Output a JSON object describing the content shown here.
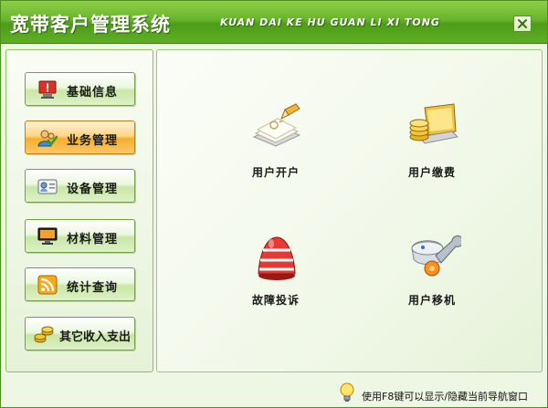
{
  "window": {
    "title": "宽带客户管理系统",
    "title_pinyin": "KUAN DAI KE HU GUAN LI XI TONG",
    "close_icon": "close-icon"
  },
  "sidebar": {
    "items": [
      {
        "label": "基础信息",
        "icon": "monitor-warning-icon",
        "active": false
      },
      {
        "label": "业务管理",
        "icon": "people-check-icon",
        "active": true
      },
      {
        "label": "设备管理",
        "icon": "contacts-card-icon",
        "active": false
      },
      {
        "label": "材料管理",
        "icon": "display-monitor-icon",
        "active": false
      },
      {
        "label": "统计查询",
        "icon": "rss-feed-icon",
        "active": false
      },
      {
        "label": "其它收入支出",
        "icon": "coins-icon",
        "active": false
      }
    ]
  },
  "main": {
    "tiles": [
      {
        "label": "用户开户",
        "icon": "notebook-pencil-icon"
      },
      {
        "label": "用户缴费",
        "icon": "laptop-coins-icon"
      },
      {
        "label": "故障投诉",
        "icon": "alarm-bell-icon"
      },
      {
        "label": "用户移机",
        "icon": "network-wrench-icon"
      }
    ]
  },
  "status": {
    "hint": "使用F8键可以显示/隐藏当前导航窗口",
    "icon": "lightbulb-icon"
  },
  "colors": {
    "titlebar": "#5faf25",
    "active_button": "#f6ae2c",
    "button": "#c8e7a6",
    "panel_border": "#8fbf62"
  }
}
